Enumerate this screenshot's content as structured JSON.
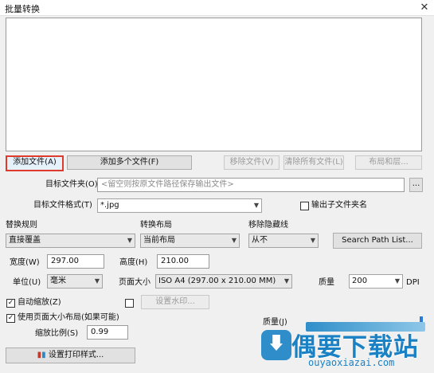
{
  "window": {
    "title": "批量转换",
    "close_glyph": "✕"
  },
  "buttons": {
    "add_file": "添加文件(A)",
    "add_multiple": "添加多个文件(F)",
    "remove_file": "移除文件(V)",
    "remove_all": "清除所有文件(L)",
    "layout": "布局和层...",
    "browse": "...",
    "search_path": "Search Path List...",
    "watermark": "设置水印...",
    "print_style": "设置打印样式..."
  },
  "target": {
    "folder_label": "目标文件夹(O)",
    "folder_placeholder": "<留空则按原文件路径保存输出文件>",
    "format_label": "目标文件格式(T)",
    "format_value": "*.jpg",
    "subfolder_label": "输出子文件夹名"
  },
  "options": {
    "replace_label": "替换规则",
    "replace_value": "直接覆盖",
    "layout_label": "转换布局",
    "layout_value": "当前布局",
    "hidden_label": "移除隐藏线",
    "hidden_value": "从不"
  },
  "size": {
    "width_label": "宽度(W)",
    "width_value": "297.00",
    "height_label": "高度(H)",
    "height_value": "210.00",
    "unit_label": "单位(U)",
    "unit_value": "毫米",
    "page_label": "页面大小",
    "page_value": "ISO A4 (297.00 x 210.00 MM)",
    "quality_label": "质量",
    "quality_value": "200",
    "dpi_label": "DPI"
  },
  "scaling": {
    "auto_zoom_label": "自动缩放(Z)",
    "auto_zoom_checked": true,
    "watermark_checked": false,
    "use_layout_label": "使用页面大小布局(如果可能)",
    "use_layout_checked": true,
    "ratio_label": "缩放比例(S)",
    "ratio_value": "0.99",
    "quality_slider_label": "质量(J)"
  },
  "watermark_logo": {
    "name": "偶要下载站",
    "url": "ouyaoxiazai.com"
  },
  "colors": {
    "highlight": "#e03a2c",
    "brand": "#1a82c4"
  }
}
